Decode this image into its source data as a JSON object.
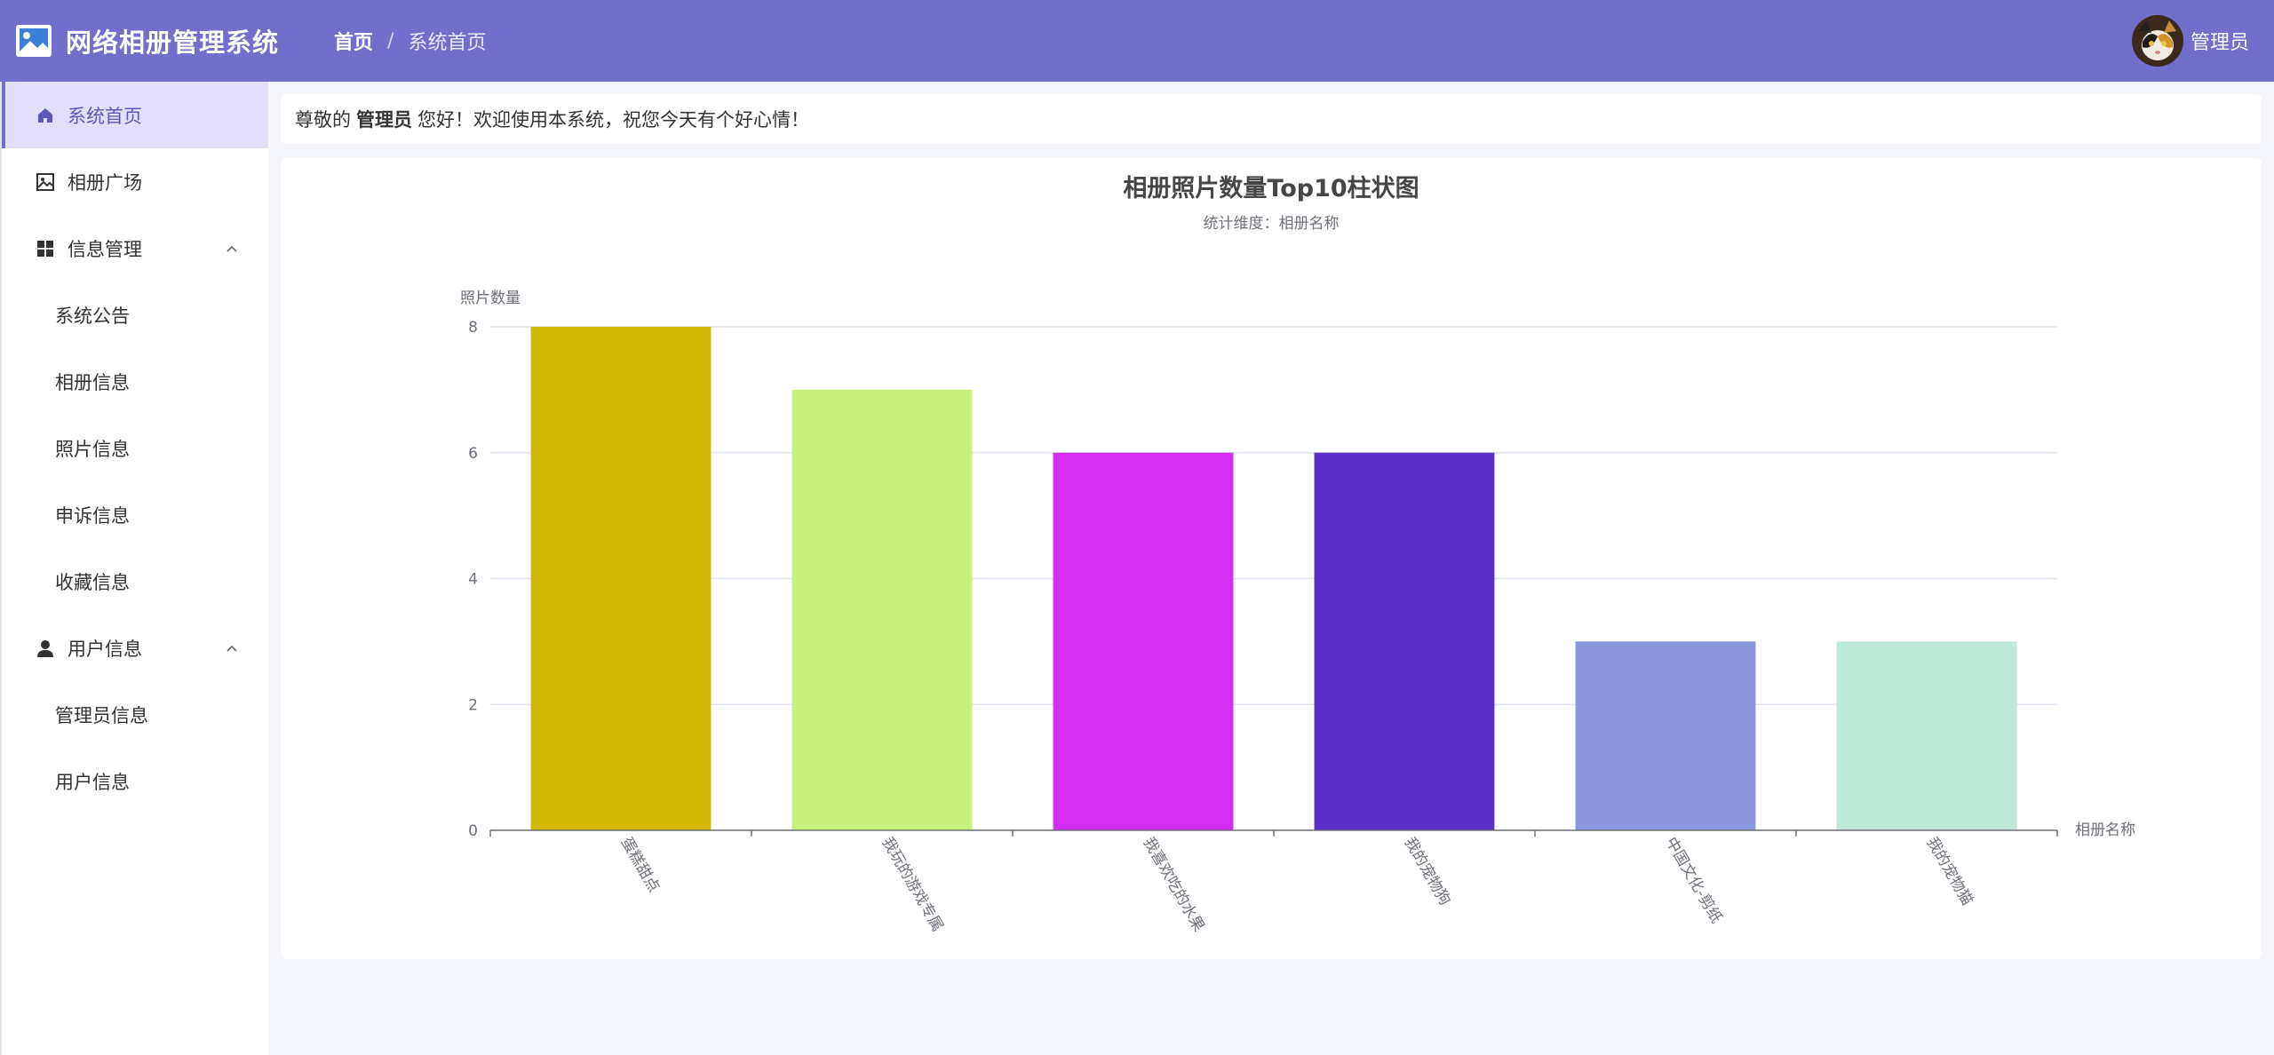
{
  "app": {
    "title": "网络相册管理系统"
  },
  "breadcrumb": {
    "home": "首页",
    "separator": "/",
    "current": "系统首页"
  },
  "user": {
    "name": "管理员"
  },
  "sidebar": {
    "items": [
      {
        "label": "系统首页",
        "icon": "home-icon",
        "active": true
      },
      {
        "label": "相册广场",
        "icon": "picture-icon"
      },
      {
        "label": "信息管理",
        "icon": "grid-icon",
        "expanded": true,
        "children": [
          "系统公告",
          "相册信息",
          "照片信息",
          "申诉信息",
          "收藏信息"
        ]
      },
      {
        "label": "用户信息",
        "icon": "user-icon",
        "expanded": true,
        "children": [
          "管理员信息",
          "用户信息"
        ]
      }
    ]
  },
  "welcome": {
    "prefix": "尊敬的",
    "role": "管理员",
    "suffix": "您好！欢迎使用本系统，祝您今天有个好心情！"
  },
  "colors": {
    "header_bg": "#736dcc",
    "active_bg": "#e3dffb",
    "active_text": "#5e57b9"
  },
  "chart_data": {
    "type": "bar",
    "title": "相册照片数量Top10柱状图",
    "subtitle": "统计维度：相册名称",
    "ylabel": "照片数量",
    "xlabel": "相册名称",
    "ylim": [
      0,
      8
    ],
    "yticks": [
      0,
      2,
      4,
      6,
      8
    ],
    "grid": true,
    "categories": [
      "蛋糕甜点",
      "我玩的游戏专属",
      "我喜欢吃的水果",
      "我的宠物狗",
      "中国文化-剪纸",
      "我的宠物猫"
    ],
    "values": [
      8,
      7,
      6,
      6,
      3,
      3
    ],
    "colors": [
      "#d4b806",
      "#c5f17c",
      "#d42ef2",
      "#5b30c8",
      "#8a96de",
      "#bde9d8"
    ]
  }
}
